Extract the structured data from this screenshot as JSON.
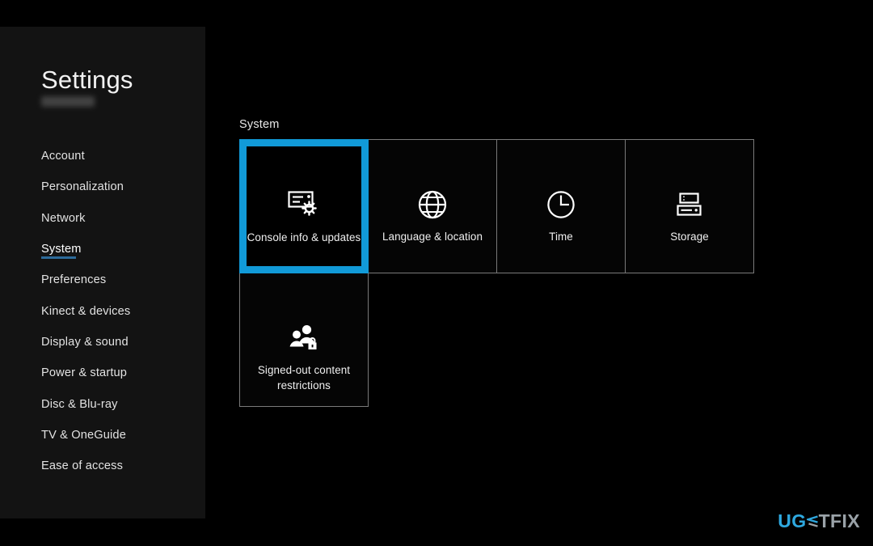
{
  "window": {
    "background_color": "#000000",
    "sidebar_color": "#131313"
  },
  "sidebar": {
    "title": "Settings",
    "gamertag": "",
    "accent_underline_color": "#2d6b9a",
    "items": [
      {
        "label": "Account",
        "active": false
      },
      {
        "label": "Personalization",
        "active": false
      },
      {
        "label": "Network",
        "active": false
      },
      {
        "label": "System",
        "active": true
      },
      {
        "label": "Preferences",
        "active": false
      },
      {
        "label": "Kinect & devices",
        "active": false
      },
      {
        "label": "Display & sound",
        "active": false
      },
      {
        "label": "Power & startup",
        "active": false
      },
      {
        "label": "Disc & Blu-ray",
        "active": false
      },
      {
        "label": "TV & OneGuide",
        "active": false
      },
      {
        "label": "Ease of access",
        "active": false
      }
    ]
  },
  "main": {
    "section_header": "System",
    "selection_color": "#119ad8",
    "tile_border_color": "#7a7a7a",
    "tiles": [
      {
        "label": "Console info & updates",
        "icon": "console-gear-icon",
        "selected": true
      },
      {
        "label": "Language & location",
        "icon": "globe-icon",
        "selected": false
      },
      {
        "label": "Time",
        "icon": "clock-icon",
        "selected": false
      },
      {
        "label": "Storage",
        "icon": "storage-icon",
        "selected": false
      },
      {
        "label": "Signed-out content restrictions",
        "icon": "people-lock-icon",
        "selected": false
      }
    ]
  },
  "watermark": {
    "part1": "UG",
    "part2": "TFIX",
    "color1": "#2ea8df",
    "color2": "#9aa2a8"
  }
}
